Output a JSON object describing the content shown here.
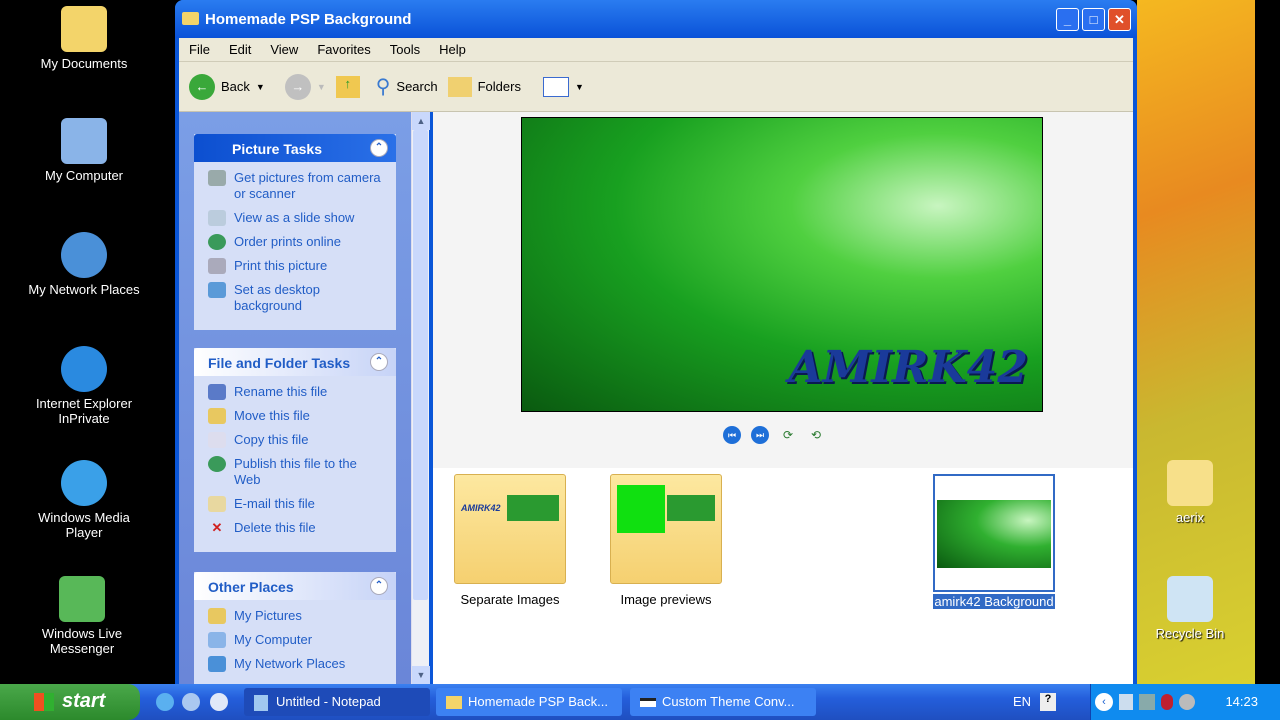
{
  "desktop": {
    "icons": [
      "My Documents",
      "My Computer",
      "My Network Places",
      "Internet Explorer InPrivate",
      "Windows Media Player",
      "Windows Live Messenger"
    ],
    "right_icons": [
      "aerix",
      "Recycle Bin"
    ]
  },
  "window": {
    "title": "Homemade PSP Background",
    "menu": [
      "File",
      "Edit",
      "View",
      "Favorites",
      "Tools",
      "Help"
    ],
    "toolbar": {
      "back": "Back",
      "search": "Search",
      "folders": "Folders"
    }
  },
  "picture_tasks": {
    "title": "Picture Tasks",
    "items": [
      "Get pictures from camera or scanner",
      "View as a slide show",
      "Order prints online",
      "Print this picture",
      "Set as desktop background"
    ]
  },
  "file_tasks": {
    "title": "File and Folder Tasks",
    "items": [
      "Rename this file",
      "Move this file",
      "Copy this file",
      "Publish this file to the Web",
      "E-mail this file",
      "Delete this file"
    ]
  },
  "other_places": {
    "title": "Other Places",
    "items": [
      "My Pictures",
      "My Computer",
      "My Network Places"
    ]
  },
  "preview": {
    "logo_text": "AMIRK42"
  },
  "files": [
    {
      "name": "Separate Images"
    },
    {
      "name": "Image previews"
    },
    {
      "name": "amirk42 Background"
    }
  ],
  "taskbar": {
    "start": "start",
    "tasks": [
      "Untitled - Notepad",
      "Homemade PSP Back...",
      "Custom Theme Conv..."
    ],
    "lang": "EN",
    "time": "14:23"
  }
}
